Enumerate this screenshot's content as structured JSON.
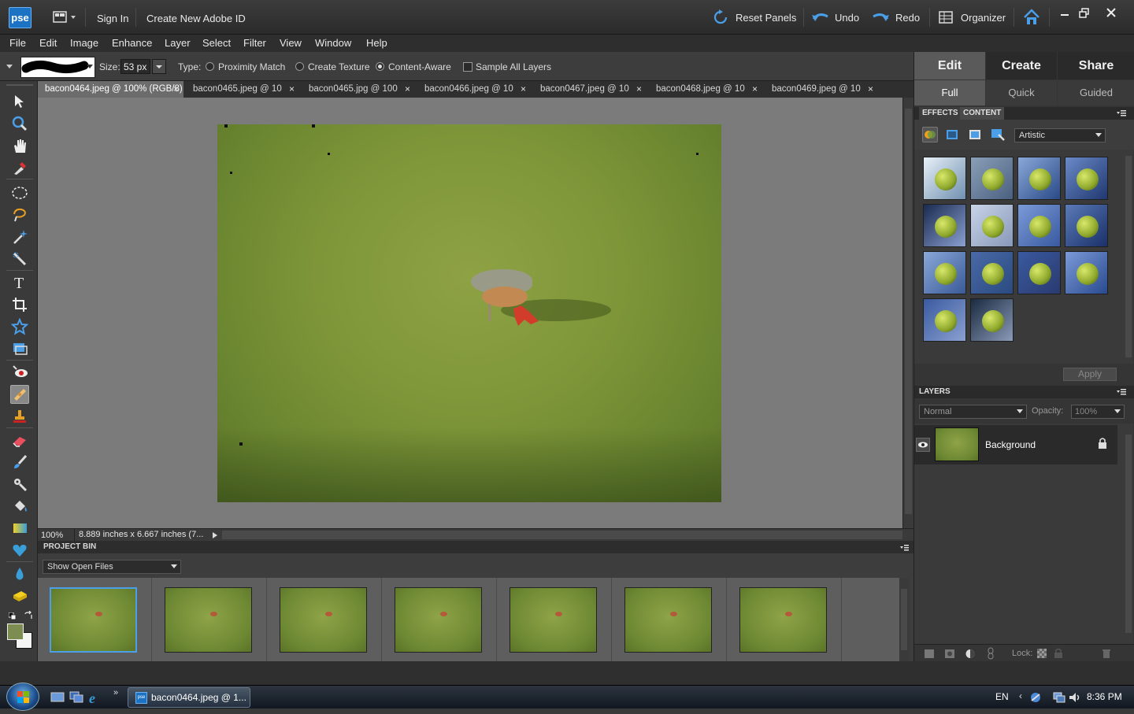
{
  "app": {
    "logo": "pse",
    "sign_in": "Sign In",
    "create_id": "Create New Adobe ID",
    "reset_panels": "Reset Panels",
    "undo": "Undo",
    "redo": "Redo",
    "organizer": "Organizer"
  },
  "menu": [
    "File",
    "Edit",
    "Image",
    "Enhance",
    "Layer",
    "Select",
    "Filter",
    "View",
    "Window",
    "Help"
  ],
  "options": {
    "size_label": "Size:",
    "size_value": "53 px",
    "type_label": "Type:",
    "proximity": "Proximity Match",
    "texture": "Create Texture",
    "content_aware": "Content-Aware",
    "selected_type": "Content-Aware",
    "sample_all": "Sample All Layers"
  },
  "tabs": [
    {
      "label": "bacon0464.jpeg @ 100% (RGB/8)",
      "active": true
    },
    {
      "label": "bacon0465.jpeg @ 10...",
      "active": false
    },
    {
      "label": "bacon0465.jpg @ 100...",
      "active": false
    },
    {
      "label": "bacon0466.jpeg @ 10...",
      "active": false
    },
    {
      "label": "bacon0467.jpeg @ 10...",
      "active": false
    },
    {
      "label": "bacon0468.jpeg @ 10...",
      "active": false
    },
    {
      "label": "bacon0469.jpeg @ 10...",
      "active": false
    }
  ],
  "status": {
    "zoom": "100%",
    "dimensions": "8.889 inches x 6.667 inches (7..."
  },
  "project_bin": {
    "title": "PROJECT BIN",
    "dropdown": "Show Open Files"
  },
  "right_panel": {
    "tabs": [
      "Edit",
      "Create",
      "Share"
    ],
    "active_tab": "Edit",
    "subtabs": [
      "Full",
      "Quick",
      "Guided"
    ],
    "active_subtab": "Full",
    "effects_label": "EFFECTS",
    "content_label": "CONTENT",
    "effects_dropdown": "Artistic",
    "apply": "Apply",
    "layers_label": "LAYERS",
    "blend_mode": "Normal",
    "opacity_label": "Opacity:",
    "opacity_value": "100%",
    "layer_name": "Background",
    "lock_label": "Lock:"
  },
  "taskbar": {
    "task": "bacon0464.jpeg @ 1...",
    "lang": "EN",
    "time": "8:36 PM"
  },
  "colors": {
    "accent": "#1c73c4",
    "grass": "#7d9538",
    "bird_red": "#d23c2a"
  }
}
